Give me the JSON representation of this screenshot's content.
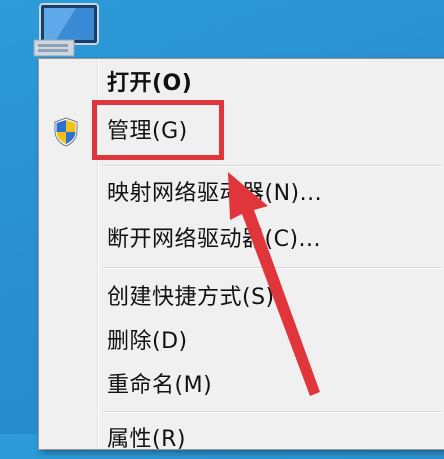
{
  "context_menu": {
    "items": [
      {
        "label": "打开(O)",
        "bold": true
      },
      {
        "label": "管理(G)",
        "icon": "uac-shield-icon"
      },
      {
        "label": "映射网络驱动器(N)..."
      },
      {
        "label": "断开网络驱动器(C)..."
      },
      {
        "label": "创建快捷方式(S)"
      },
      {
        "label": "删除(D)"
      },
      {
        "label": "重命名(M)"
      },
      {
        "label": "属性(R)"
      }
    ]
  },
  "annotation": {
    "box_color": "#e0353a",
    "arrow_color": "#e0353a",
    "target": "管理(G)"
  },
  "desktop": {
    "icon": "computer-icon",
    "background_color": "#2a8fd0"
  }
}
